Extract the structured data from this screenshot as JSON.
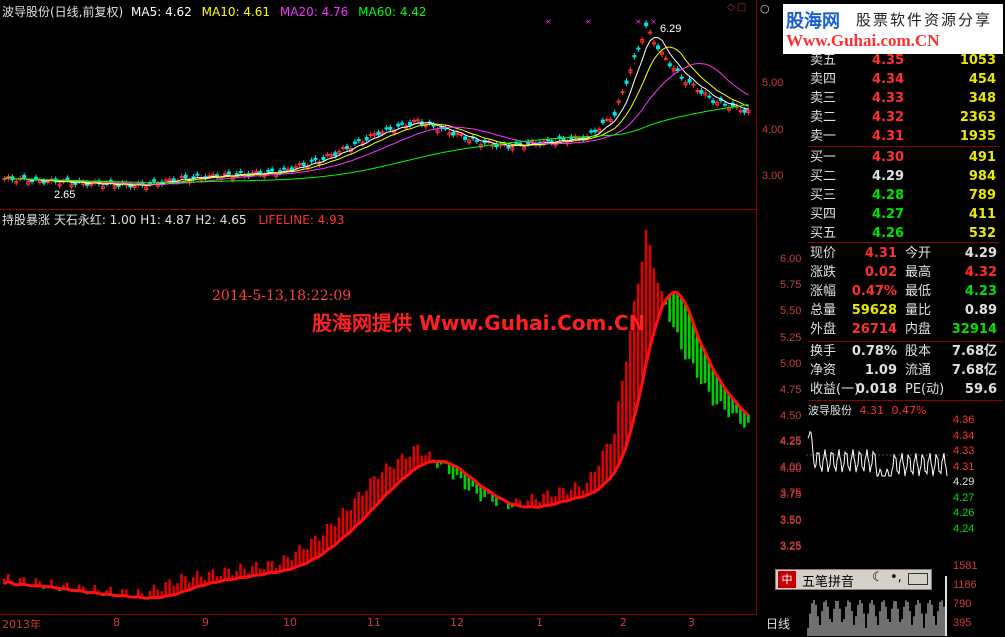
{
  "colors": {
    "up": "#ff3030",
    "down": "#00e000",
    "ma5": "#ffffff",
    "ma10": "#ffff00",
    "ma20": "#ff30ff",
    "ma60": "#00ff00",
    "frame": "#8b0000",
    "axis": "#cc3b3b"
  },
  "main_chart": {
    "title": "波导股份(日线,前复权)",
    "ma5_label": "MA5: 4.62",
    "ma10_label": "MA10: 4.61",
    "ma20_label": "MA20: 4.76",
    "ma60_label": "MA60: 4.42",
    "yticks": [
      "5.00",
      "4.00",
      "3.00"
    ],
    "high_label": "6.29",
    "low_label": "2.65"
  },
  "indicator": {
    "name_label": "持股暴涨  天石永红: 1.00  H1: 4.87  H2: 4.65",
    "lifeline_label": "LIFELINE: 4.93",
    "timestamp": "2014-5-13,18:22:09",
    "watermark": "股海网提供 Www.Guhai.Com.CN",
    "yticks": [
      "6.00",
      "5.75",
      "5.50",
      "5.25",
      "5.00",
      "4.75",
      "4.50",
      "4.25",
      "4.00",
      "3.75",
      "3.50",
      "3.25"
    ]
  },
  "xaxis": {
    "labels": [
      "2013年",
      "8",
      "9",
      "10",
      "11",
      "12",
      "1",
      "2",
      "3"
    ],
    "period": "日线"
  },
  "logo": {
    "name": "股海网",
    "slogan": "股票软件资源分享",
    "url": "Www.Guhai.com.CN"
  },
  "orderbook": {
    "sells": [
      {
        "name": "卖五",
        "price": "4.35",
        "vol": "1053"
      },
      {
        "name": "卖四",
        "price": "4.34",
        "vol": "454"
      },
      {
        "name": "卖三",
        "price": "4.33",
        "vol": "348"
      },
      {
        "name": "卖二",
        "price": "4.32",
        "vol": "2363"
      },
      {
        "name": "卖一",
        "price": "4.31",
        "vol": "1935"
      }
    ],
    "buys": [
      {
        "name": "买一",
        "price": "4.30",
        "vol": "491"
      },
      {
        "name": "买二",
        "price": "4.29",
        "vol": "984"
      },
      {
        "name": "买三",
        "price": "4.28",
        "vol": "789"
      },
      {
        "name": "买四",
        "price": "4.27",
        "vol": "411"
      },
      {
        "name": "买五",
        "price": "4.26",
        "vol": "532"
      }
    ]
  },
  "quote": {
    "rows": [
      {
        "l1": "现价",
        "v1": "4.31",
        "l2": "今开",
        "v2": "4.29"
      },
      {
        "l1": "涨跌",
        "v1": "0.02",
        "l2": "最高",
        "v2": "4.32"
      },
      {
        "l1": "涨幅",
        "v1": "0.47%",
        "l2": "最低",
        "v2": "4.23"
      },
      {
        "l1": "总量",
        "v1": "59628",
        "l2": "量比",
        "v2": "0.89"
      },
      {
        "l1": "外盘",
        "v1": "26714",
        "l2": "内盘",
        "v2": "32914"
      }
    ],
    "rows2": [
      {
        "l1": "换手",
        "v1": "0.78%",
        "l2": "股本",
        "v2": "7.68亿"
      },
      {
        "l1": "净资",
        "v1": "1.09",
        "l2": "流通",
        "v2": "7.68亿"
      },
      {
        "l1": "收益(一)",
        "v1": "0.018",
        "l2": "PE(动)",
        "v2": "59.6"
      }
    ]
  },
  "mini_chart": {
    "title": "波导股份",
    "price": "4.31",
    "pct": "0.47%",
    "left_ticks": [
      "4.25",
      "4.00",
      "3.75",
      "3.50",
      "3.25"
    ],
    "right_ticks": [
      "4.36",
      "4.34",
      "4.33",
      "4.31",
      "4.29",
      "4.27",
      "4.26",
      "4.24"
    ],
    "vol_ticks": [
      "1581",
      "1186",
      "790",
      "395"
    ]
  },
  "ime": {
    "label": "五笔拼音"
  }
}
